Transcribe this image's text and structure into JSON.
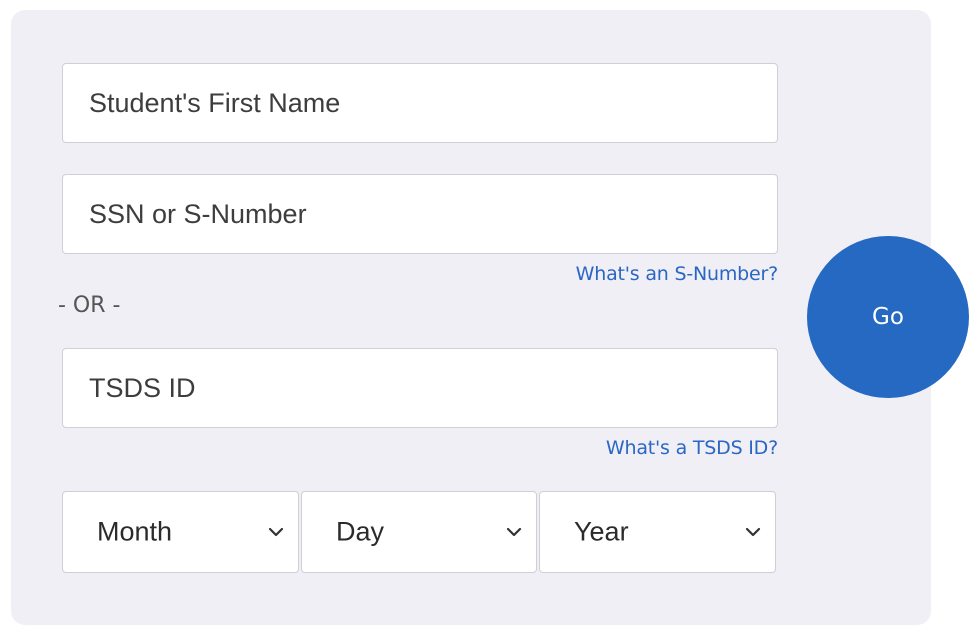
{
  "form": {
    "first_name": {
      "value": "",
      "placeholder": "Student's First Name"
    },
    "ssn": {
      "value": "",
      "placeholder": "SSN or S-Number"
    },
    "s_number_help": "What's an S-Number?",
    "or_divider": "- OR -",
    "tsds": {
      "value": "",
      "placeholder": "TSDS ID"
    },
    "tsds_help": "What's a TSDS ID?",
    "dob": {
      "month": "Month",
      "day": "Day",
      "year": "Year"
    },
    "submit_label": "Go"
  },
  "icons": {
    "dropdown": "chevron-down-icon"
  },
  "colors": {
    "panel_background": "#efeff5",
    "accent": "#2569c3",
    "link": "#2a66c4"
  }
}
